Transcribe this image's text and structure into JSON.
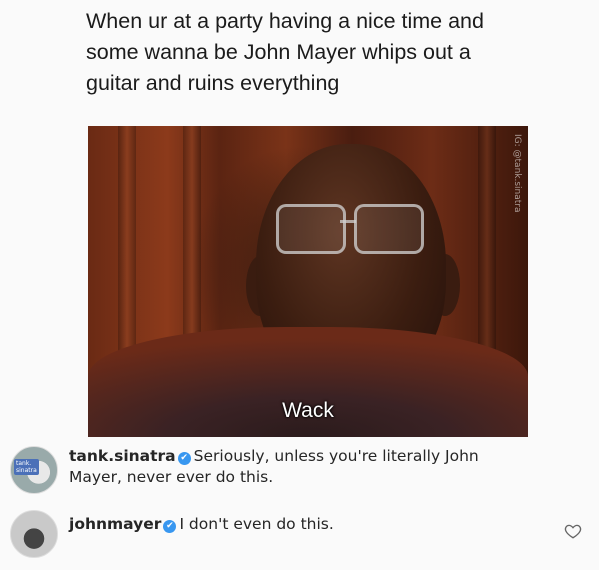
{
  "post": {
    "text": "When ur at a party having a nice time and\nsome wanna be John Mayer whips out a\nguitar and ruins everything"
  },
  "meme": {
    "caption": "Wack",
    "watermark": "IG: @tank.sinatra"
  },
  "comments": [
    {
      "avatar_label": "tank.\nsinatra",
      "username": "tank.sinatra",
      "verified": true,
      "verified_icon": "✔",
      "text": "Seriously, unless you're literally John Mayer, never ever do this."
    },
    {
      "username": "johnmayer",
      "verified": true,
      "verified_icon": "✔",
      "text": "I don't even do this."
    }
  ],
  "colors": {
    "verified": "#3897f0",
    "text": "#262626"
  }
}
